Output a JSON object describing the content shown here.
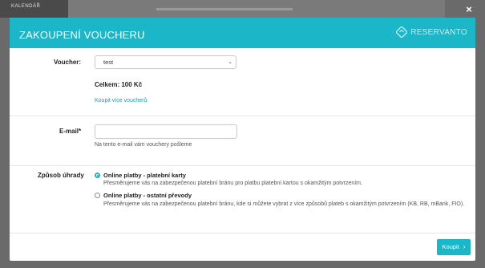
{
  "background": {
    "nav_label": "KALENDÁŘ"
  },
  "modal": {
    "title": "ZAKOUPENÍ VOUCHERU",
    "brand": "RESERVANTO",
    "close": "×"
  },
  "voucher": {
    "label": "Voucher:",
    "selected": "test",
    "total": "Celkem: 100 Kč",
    "more_link": "Koupit více voucherů"
  },
  "email": {
    "label": "E-mail*",
    "value": "",
    "hint": "Na tento e-mail vám vouchery pošleme"
  },
  "payment": {
    "label": "Způsob úhrady",
    "options": [
      {
        "title": "Online platby - platební karty",
        "desc": "Přesměrujeme vás na zabezpečenou platební bránu pro platbu platební kartou s okamžitým potvrzením.",
        "selected": true
      },
      {
        "title": "Online platby - ostatní převody",
        "desc": "Přesměrujeme vás na zabezpečenou platební bránu, kde si můžete vybrat z více způsobů plateb s okamžitým potvrzením (KB, RB, mBank, FIO).",
        "selected": false
      }
    ]
  },
  "footer": {
    "buy_label": "Koupit"
  },
  "colors": {
    "accent": "#1bb6c8",
    "link": "#1a9fb3"
  }
}
